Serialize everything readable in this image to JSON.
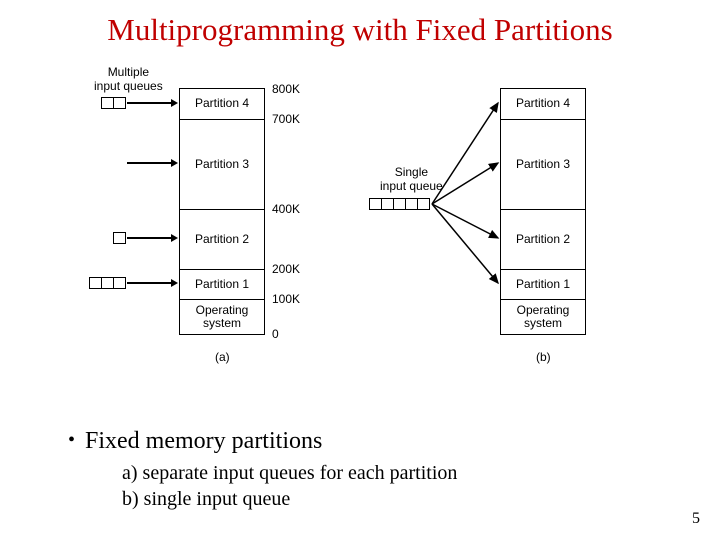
{
  "title": "Multiprogramming with Fixed Partitions",
  "labels": {
    "multi_queue": "Multiple\ninput queues",
    "single_queue": "Single\ninput queue"
  },
  "sizes": [
    "800K",
    "700K",
    "400K",
    "200K",
    "100K",
    "0"
  ],
  "partitions": {
    "p4": "Partition 4",
    "p3": "Partition 3",
    "p2": "Partition 2",
    "p1": "Partition 1",
    "os": "Operating\nsystem"
  },
  "sub_a": "(a)",
  "sub_b": "(b)",
  "bullet": "Fixed memory partitions",
  "line_a": "a) separate input queues for each partition",
  "line_b": "b) single input queue",
  "page": "5"
}
